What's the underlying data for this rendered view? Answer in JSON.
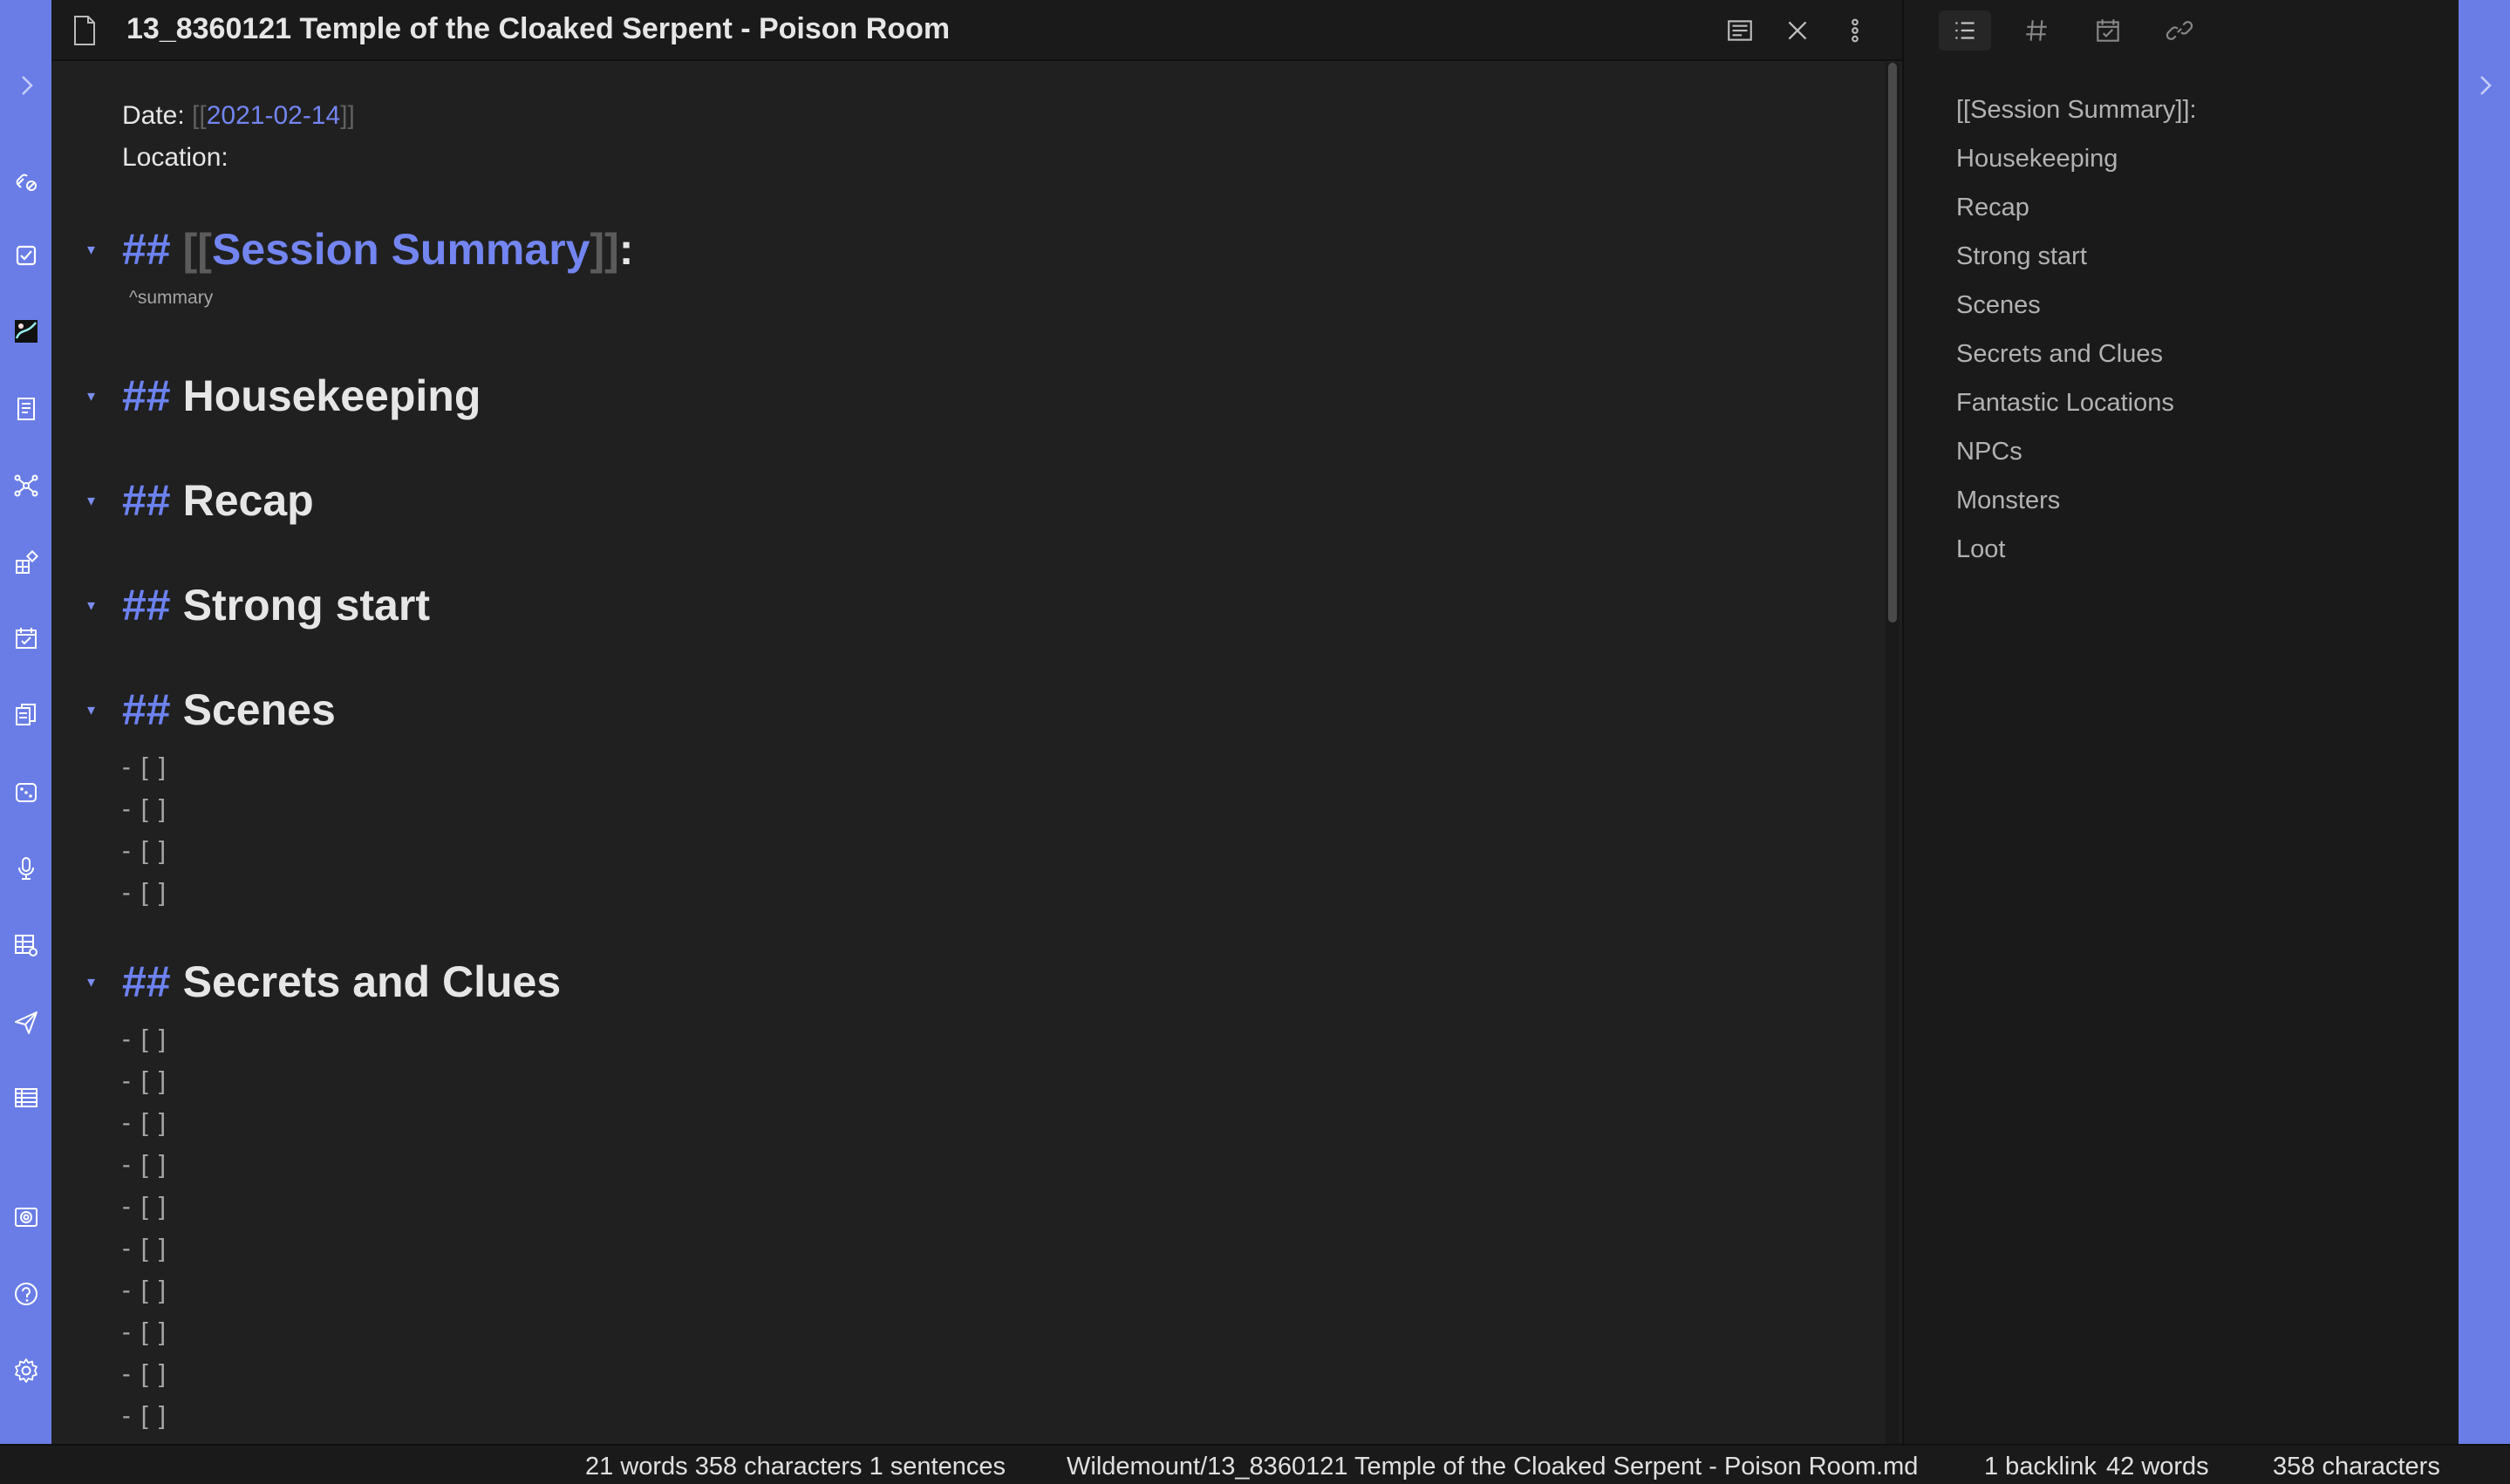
{
  "editor": {
    "title": "13_8360121 Temple of the Cloaked Serpent - Poison Room",
    "date_label": "Date: ",
    "date_open": "[[",
    "date_link": "2021-02-14",
    "date_close": "]]",
    "location_label": "Location:",
    "headings": {
      "hash": "##",
      "summary_open": "[[",
      "summary_link": "Session Summary",
      "summary_close": "]]",
      "summary_colon": ":",
      "housekeeping": "Housekeeping",
      "recap": "Recap",
      "strong_start": "Strong start",
      "scenes": "Scenes",
      "secrets": "Secrets and Clues"
    },
    "block_ref": "^summary",
    "task_text": "- [ ]",
    "collapse_glyph": "▾"
  },
  "outline": {
    "items": [
      "[[Session Summary]]:",
      "Housekeeping",
      "Recap",
      "Strong start",
      "Scenes",
      "Secrets and Clues",
      "Fantastic Locations",
      "NPCs",
      "Monsters",
      "Loot"
    ]
  },
  "statusbar": {
    "selection_stats": "21 words 358 characters 1 sentences",
    "file_path": "Wildemount/13_8360121 Temple of the Cloaked Serpent - Poison Room.md",
    "backlinks": "1 backlink",
    "words": "42 words",
    "characters": "358 characters"
  },
  "colors": {
    "accent": "#6a7de6",
    "link": "#7385f0",
    "background": "#202020",
    "panel": "#1a1a1a"
  },
  "icons": {
    "ribbon": [
      "collapse-left-icon",
      "link-broken-icon",
      "checkbox-icon",
      "image-map-icon",
      "document-list-icon",
      "graph-view-icon",
      "plugin-grid-icon",
      "calendar-check-icon",
      "copy-notes-icon",
      "dice-icon",
      "microphone-icon",
      "table-settings-icon",
      "send-icon",
      "spreadsheet-icon",
      "vault-icon",
      "help-icon",
      "settings-icon"
    ],
    "sidebar_tabs": [
      "outline-icon",
      "tag-icon",
      "calendar-icon",
      "link-icon"
    ]
  }
}
